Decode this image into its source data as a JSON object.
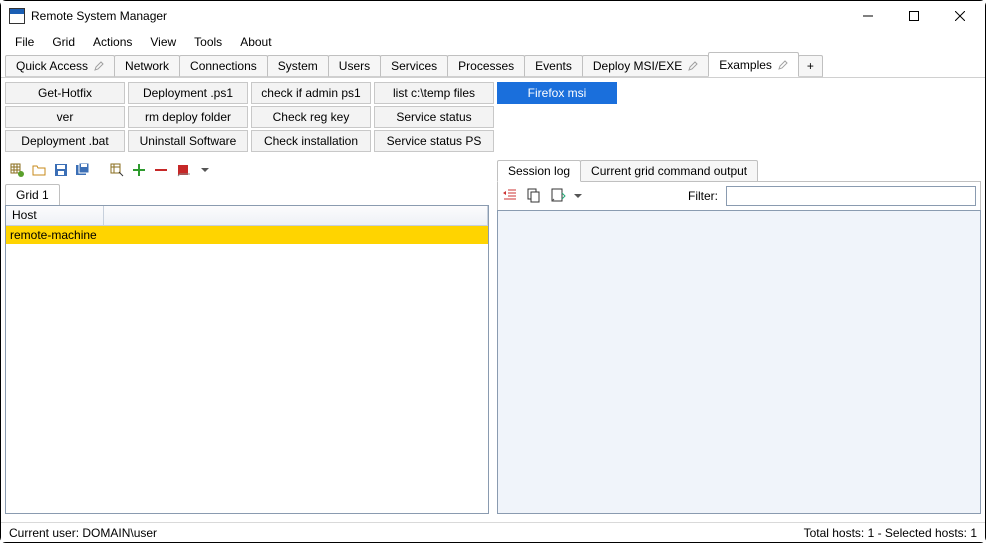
{
  "window": {
    "title": "Remote System Manager"
  },
  "menubar": [
    "File",
    "Grid",
    "Actions",
    "View",
    "Tools",
    "About"
  ],
  "tabs": [
    {
      "label": "Quick Access",
      "pencil": true
    },
    {
      "label": "Network"
    },
    {
      "label": "Connections"
    },
    {
      "label": "System"
    },
    {
      "label": "Users"
    },
    {
      "label": "Services"
    },
    {
      "label": "Processes"
    },
    {
      "label": "Events"
    },
    {
      "label": "Deploy MSI/EXE",
      "pencil": true
    },
    {
      "label": "Examples",
      "pencil": true,
      "active": true
    }
  ],
  "addTabLabel": "+",
  "commandButtons": [
    [
      "Get-Hotfix",
      "Deployment .ps1",
      "check if admin ps1",
      "list c:\\temp files",
      "Firefox msi"
    ],
    [
      "ver",
      "rm deploy folder",
      "Check reg key",
      "Service status"
    ],
    [
      "Deployment .bat",
      "Uninstall Software",
      "Check installation",
      "Service status PS"
    ]
  ],
  "highlightedButton": "Firefox msi",
  "gridTab": "Grid 1",
  "gridHeader": "Host",
  "gridRows": [
    "remote-machine"
  ],
  "rightTabs": [
    "Session log",
    "Current grid command output"
  ],
  "activeRightTab": "Session log",
  "filterLabel": "Filter:",
  "filterValue": "",
  "status": {
    "left": "Current user: DOMAIN\\user",
    "right": "Total hosts: 1 - Selected hosts: 1"
  }
}
